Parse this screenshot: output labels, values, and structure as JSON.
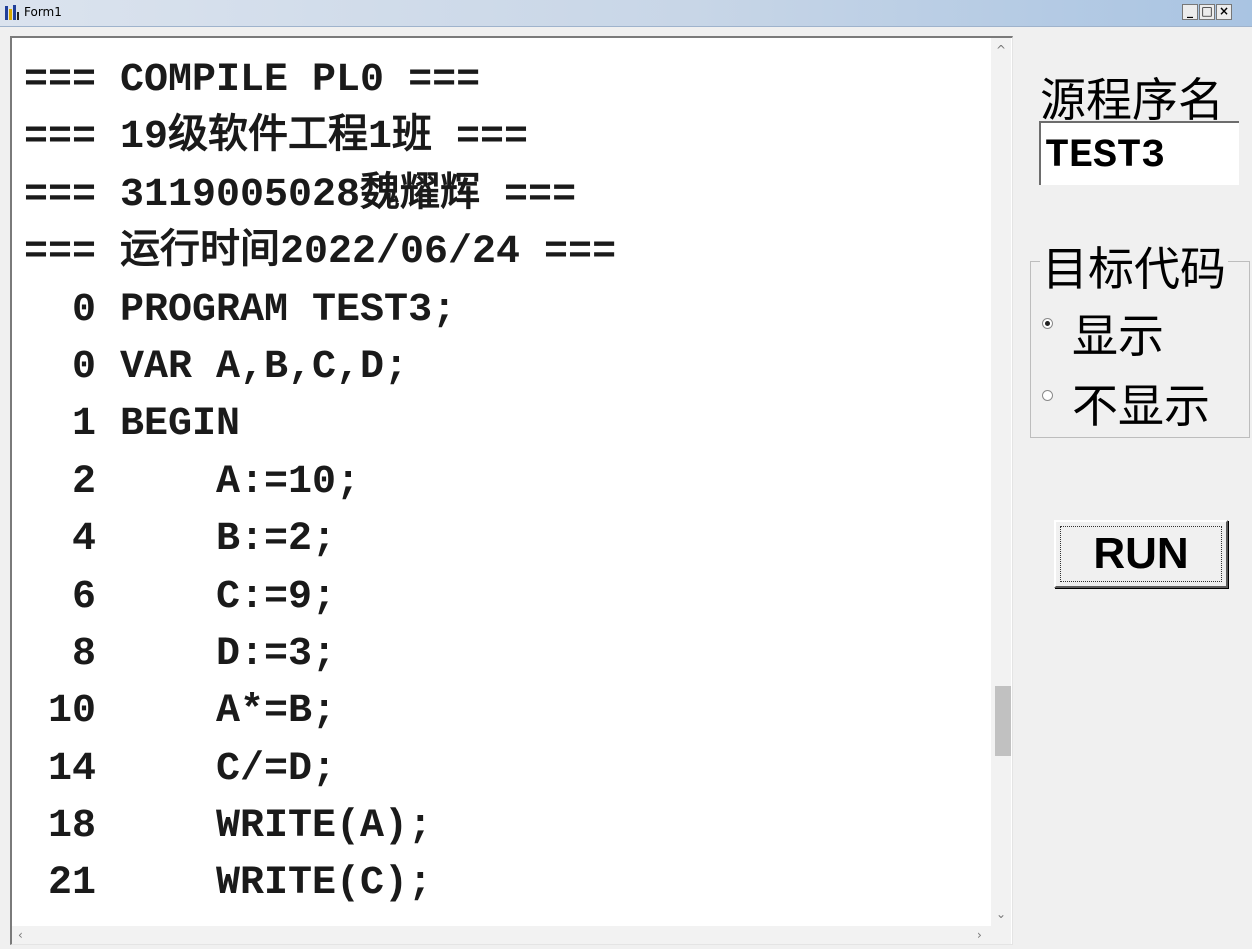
{
  "window": {
    "title": "Form1",
    "icon": "app-icon",
    "controls": {
      "minimize": "_",
      "maximize": "□",
      "close": "×"
    }
  },
  "output": {
    "lines": [
      "=== COMPILE PL0 ===",
      "=== 19级软件工程1班 ===",
      "=== 3119005028魏耀辉 ===",
      "=== 运行时间2022/06/24 ===",
      "  0 PROGRAM TEST3;",
      "  0 VAR A,B,C,D;",
      "  1 BEGIN",
      "  2     A:=10;",
      "  4     B:=2;",
      "  6     C:=9;",
      "  8     D:=3;",
      " 10     A*=B;",
      " 14     C/=D;",
      " 18     WRITE(A);",
      " 21     WRITE(C);"
    ],
    "scroll_position": 0.75
  },
  "source_name": {
    "label": "源程序名",
    "value": "TEST3"
  },
  "target_code": {
    "label": "目标代码",
    "options": [
      {
        "label": "显示",
        "selected": true
      },
      {
        "label": "不显示",
        "selected": false
      }
    ]
  },
  "run_button": {
    "label": "RUN"
  }
}
